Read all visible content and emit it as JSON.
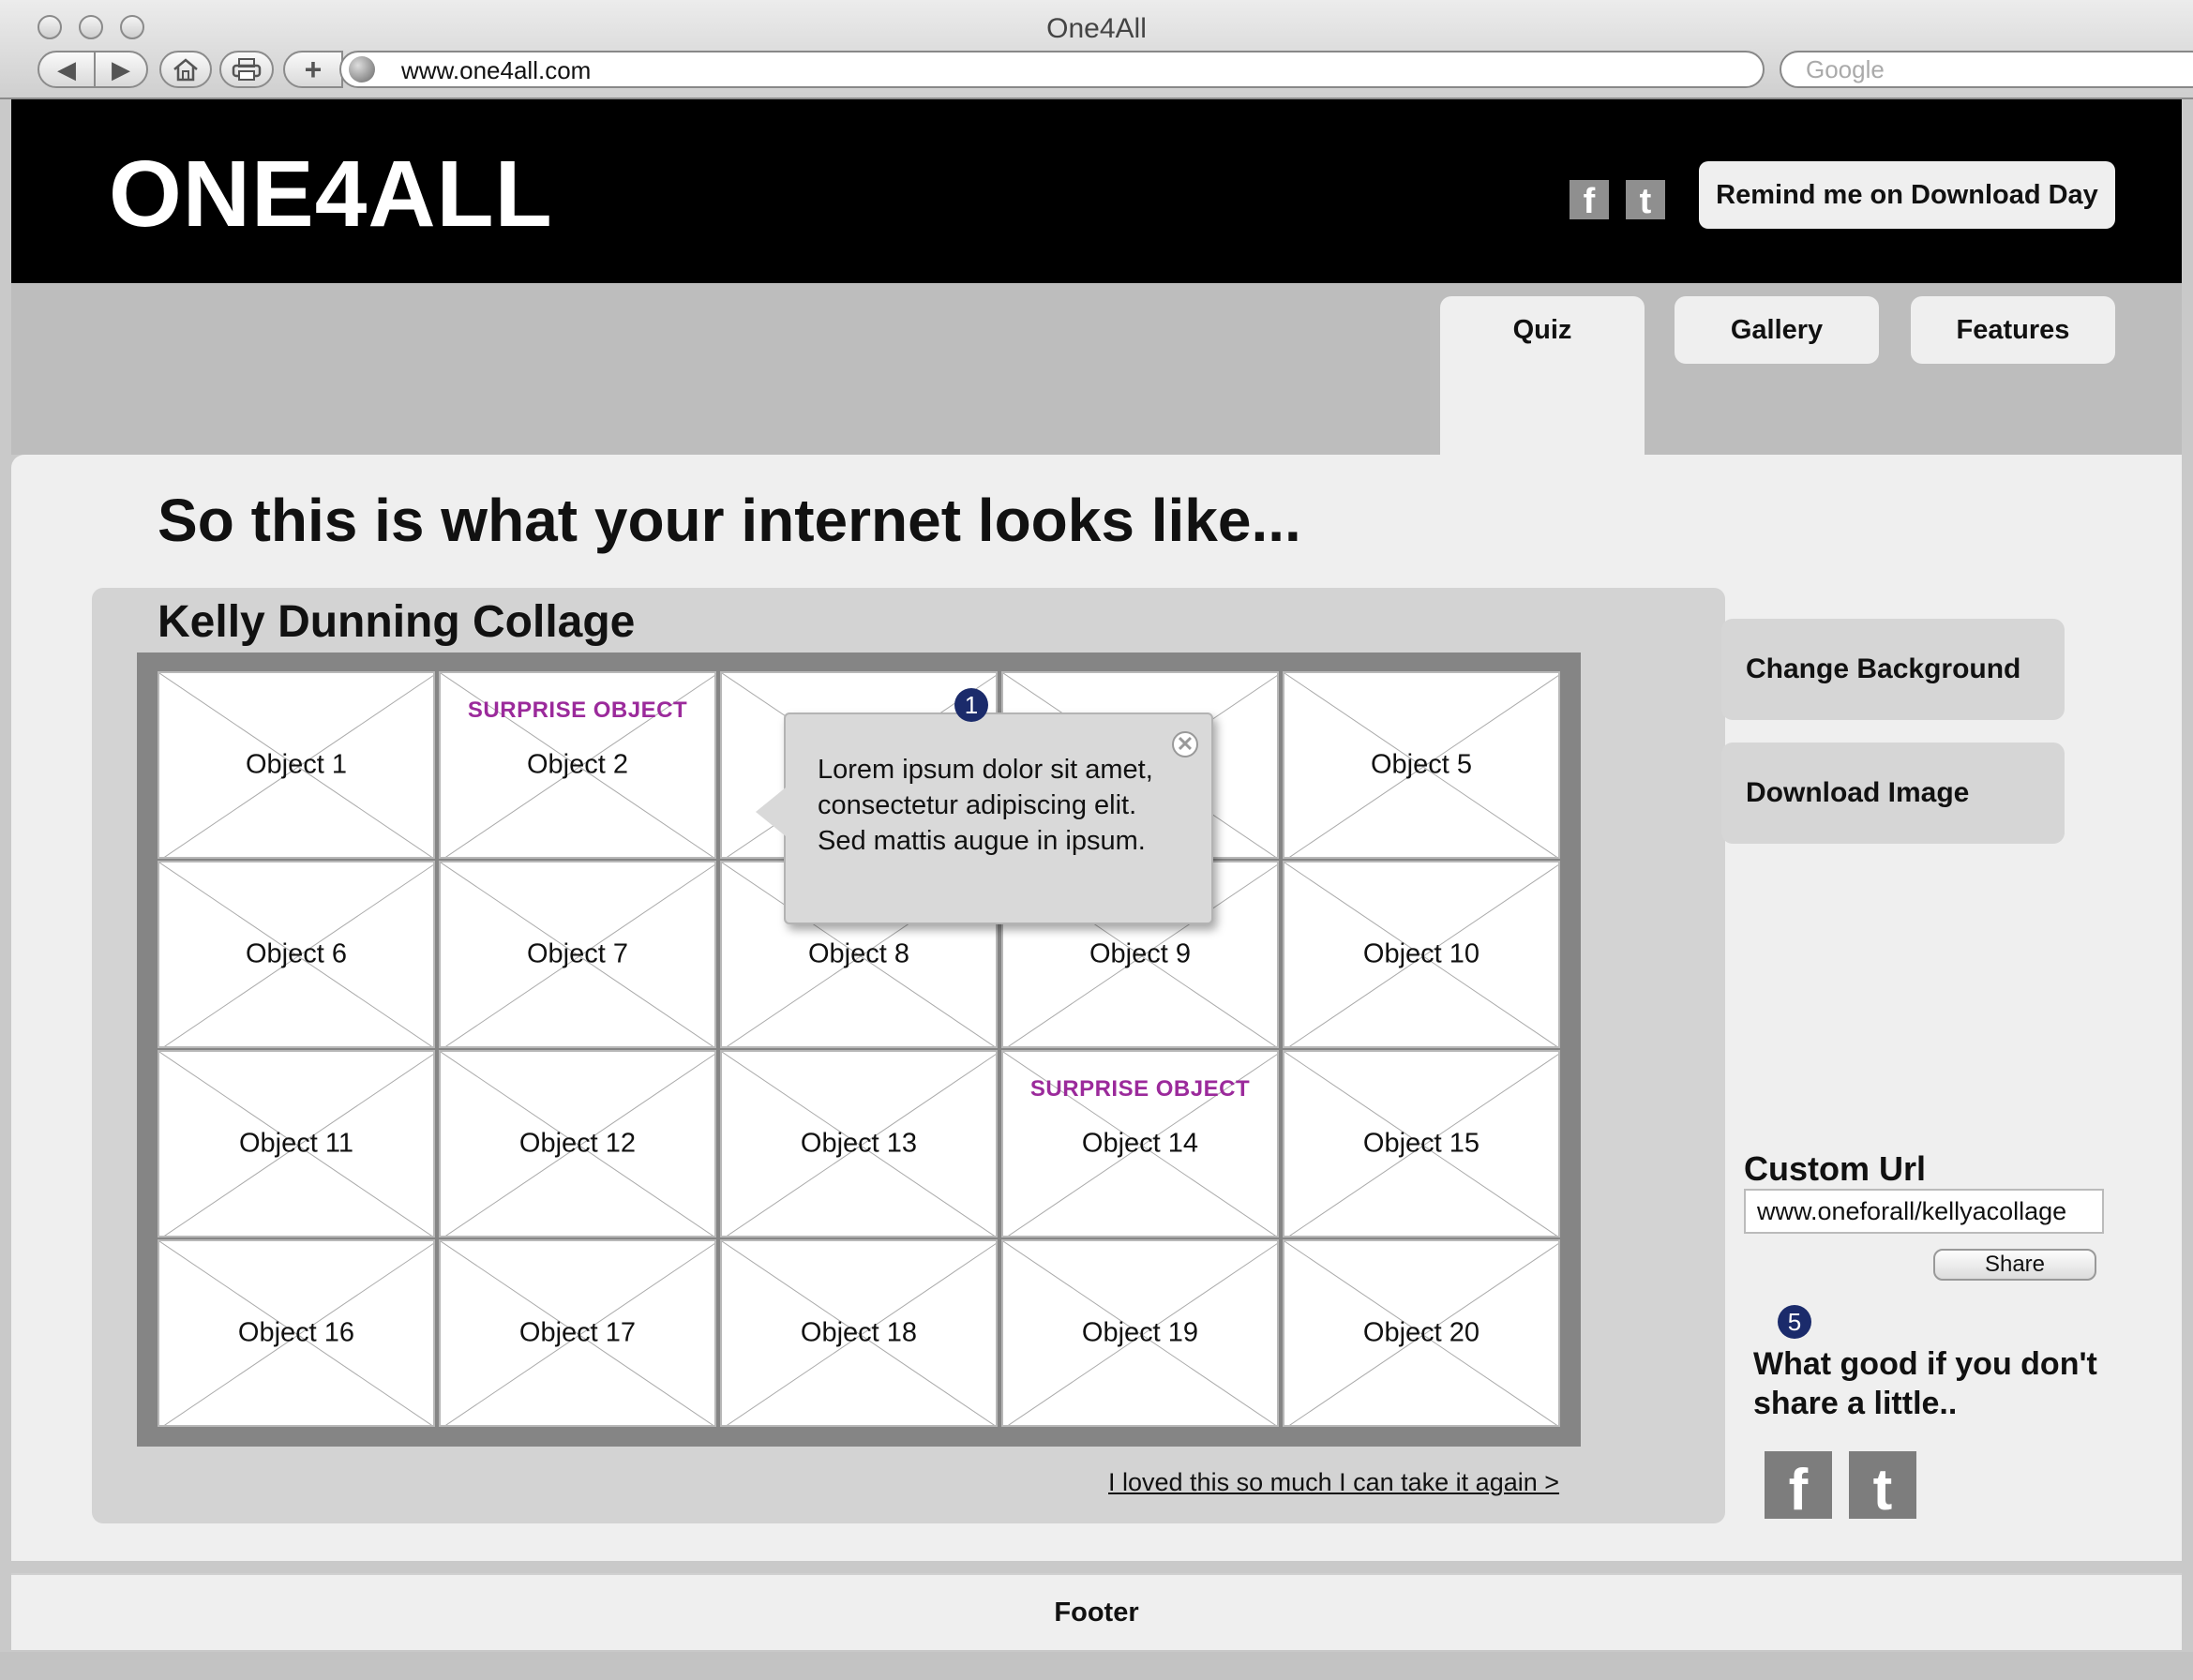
{
  "browser": {
    "window_title": "One4All",
    "address": "www.one4all.com",
    "search_placeholder": "Google"
  },
  "header": {
    "logo": "ONE4ALL",
    "remind_button": "Remind me on Download Day",
    "social_icons": [
      "facebook-icon",
      "twitter-icon"
    ]
  },
  "nav": {
    "tabs": [
      {
        "label": "Quiz",
        "active": true
      },
      {
        "label": "Gallery",
        "active": false
      },
      {
        "label": "Features",
        "active": false
      }
    ]
  },
  "main": {
    "headline": "So this is what your internet looks like...",
    "collage_title": "Kelly Dunning Collage",
    "objects": [
      {
        "label": "Object 1",
        "tag": ""
      },
      {
        "label": "Object 2",
        "tag": "SURPRISE OBJECT"
      },
      {
        "label": "",
        "tag": ""
      },
      {
        "label": "",
        "tag": ""
      },
      {
        "label": "Object 5",
        "tag": ""
      },
      {
        "label": "Object 6",
        "tag": ""
      },
      {
        "label": "Object 7",
        "tag": ""
      },
      {
        "label": "Object 8",
        "tag": ""
      },
      {
        "label": "Object 9",
        "tag": ""
      },
      {
        "label": "Object 10",
        "tag": ""
      },
      {
        "label": "Object 11",
        "tag": ""
      },
      {
        "label": "Object 12",
        "tag": ""
      },
      {
        "label": "Object 13",
        "tag": ""
      },
      {
        "label": "Object 14",
        "tag": "SURPRISE OBJECT"
      },
      {
        "label": "Object 15",
        "tag": ""
      },
      {
        "label": "Object 16",
        "tag": ""
      },
      {
        "label": "Object 17",
        "tag": ""
      },
      {
        "label": "Object 18",
        "tag": ""
      },
      {
        "label": "Object 19",
        "tag": ""
      },
      {
        "label": "Object 20",
        "tag": ""
      }
    ],
    "tooltip": {
      "badge": "1",
      "lines": [
        "Lorem ipsum dolor sit amet,",
        "consectetur adipiscing elit.",
        "Sed mattis augue in ipsum."
      ]
    },
    "retake_link": "I loved this so much I can take it again >"
  },
  "sidebar": {
    "change_background": "Change Background",
    "download_image": "Download Image",
    "custom_url_title": "Custom Url",
    "custom_url_value": "www.oneforall/kellyacollage",
    "share_button": "Share",
    "share_badge": "5",
    "share_note": "What good if you don't share a little.."
  },
  "footer": {
    "label": "Footer"
  },
  "colors": {
    "header_bg": "#000000",
    "surprise_tag": "#9b2a9b",
    "badge": "#1b2b6b"
  }
}
